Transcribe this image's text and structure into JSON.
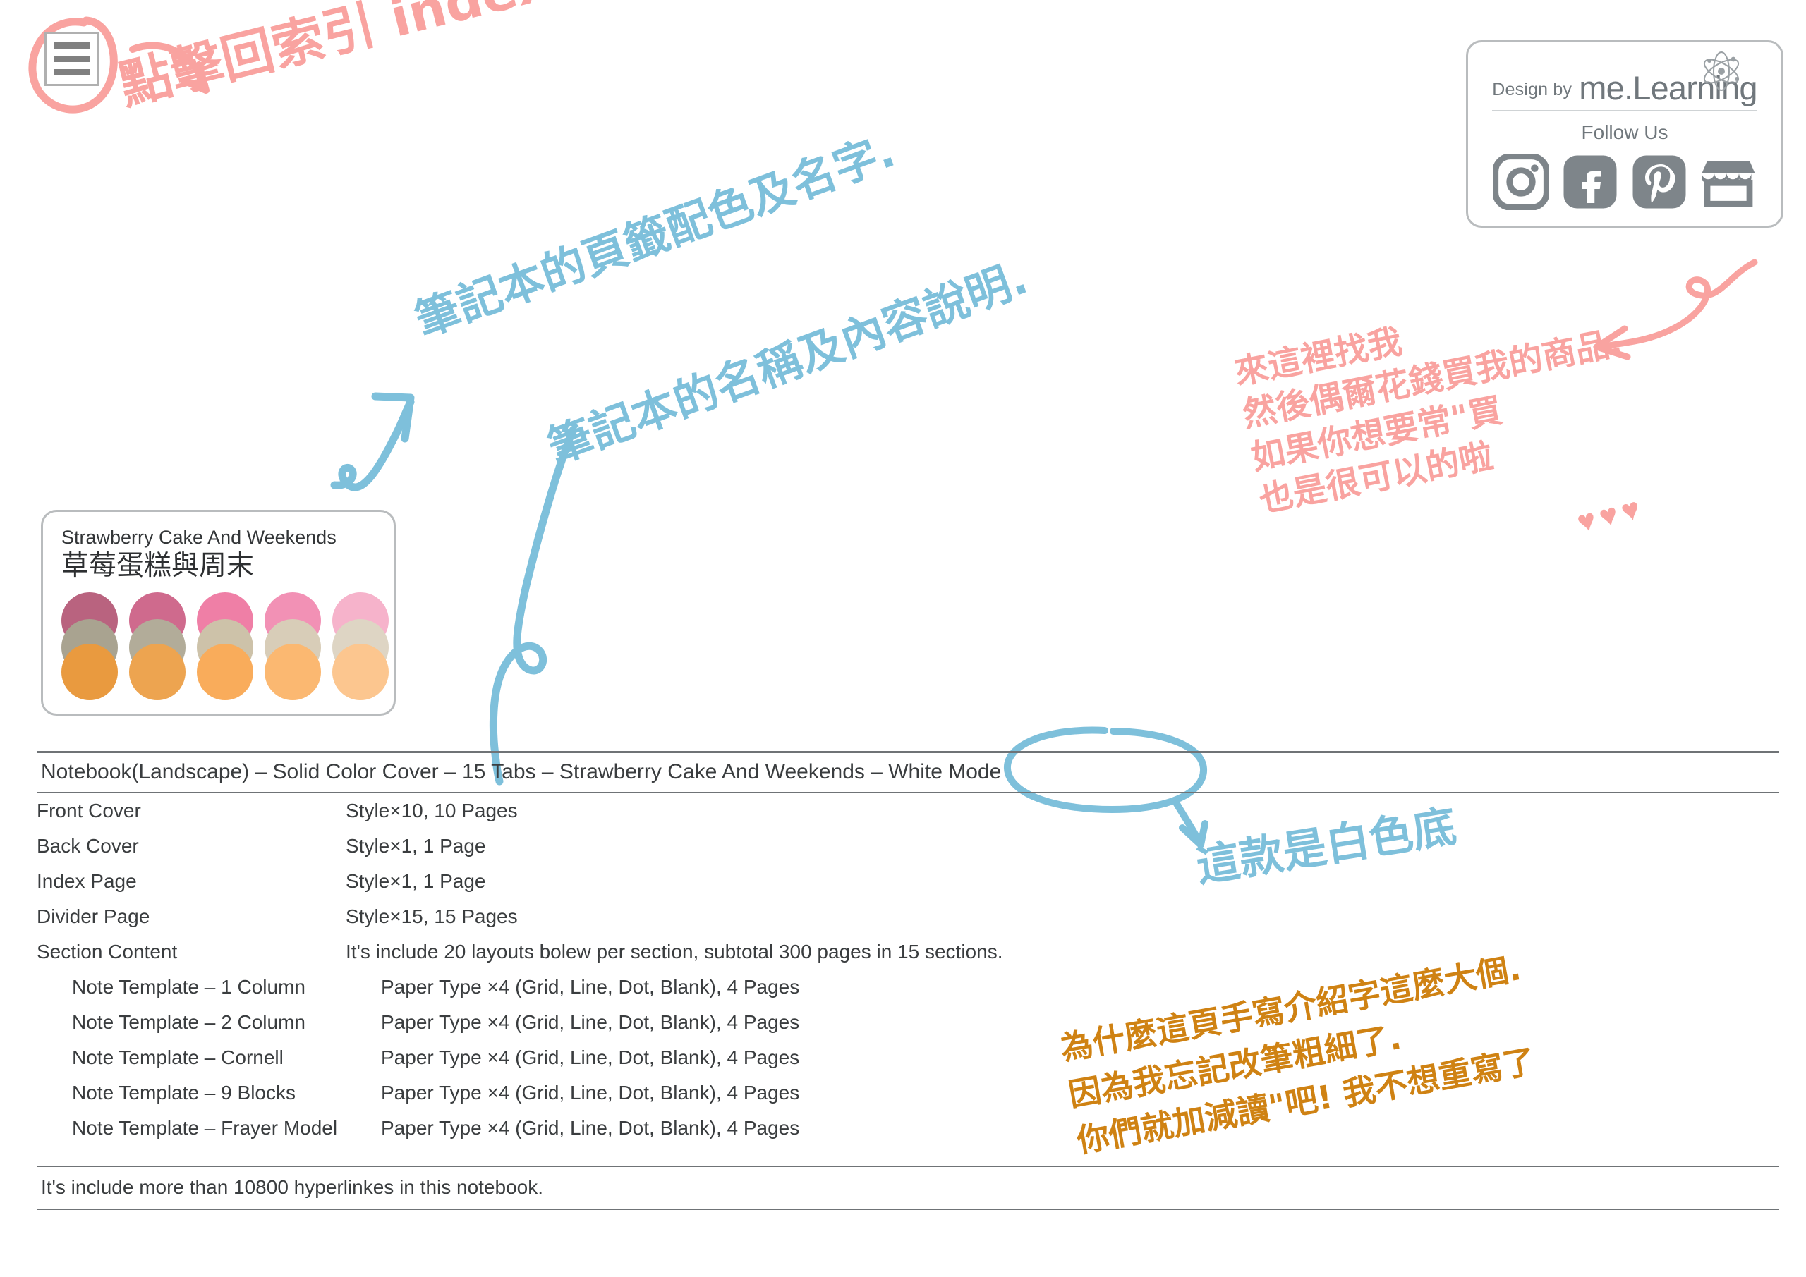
{
  "colors": {
    "pink": "#f9a3a0",
    "blue": "#7ec0db",
    "ochre": "#cf8213",
    "text": "#3a3d3f",
    "brand_gray": "#70777c",
    "border_gray": "#b9bcbe"
  },
  "index_button": {
    "name": "index-menu",
    "bars": 3
  },
  "brand": {
    "design_by": "Design by",
    "logo": "me.Learning",
    "follow_us": "Follow Us",
    "socials": [
      {
        "name": "instagram-icon",
        "label": "Instagram"
      },
      {
        "name": "facebook-icon",
        "label": "Facebook"
      },
      {
        "name": "pinterest-icon",
        "label": "Pinterest"
      },
      {
        "name": "shop-icon",
        "label": "Shop"
      }
    ],
    "atom_icon": "atom-icon"
  },
  "palette": {
    "title_en": "Strawberry Cake And Weekends",
    "title_zh": "草莓蛋糕與周末",
    "columns": [
      {
        "top": "#b9637f",
        "mid": "#a9a390",
        "bottom": "#e99a3f"
      },
      {
        "top": "#cf6a8d",
        "mid": "#b2ac99",
        "bottom": "#eda450"
      },
      {
        "top": "#ef7fa6",
        "mid": "#cdc2a9",
        "bottom": "#f9ac5b"
      },
      {
        "top": "#f291b5",
        "mid": "#d8cdb8",
        "bottom": "#fbb871"
      },
      {
        "top": "#f6b3cb",
        "mid": "#ded5c4",
        "bottom": "#fcc68f"
      }
    ]
  },
  "table": {
    "title": "Notebook(Landscape) – Solid Color Cover – 15 Tabs – Strawberry Cake And Weekends –  White Mode",
    "rows": [
      {
        "label": "Front Cover",
        "value": "Style×10, 10 Pages",
        "indent": 0
      },
      {
        "label": "Back Cover",
        "value": "Style×1, 1 Page",
        "indent": 0
      },
      {
        "label": "Index Page",
        "value": "Style×1, 1 Page",
        "indent": 0
      },
      {
        "label": "Divider Page",
        "value": "Style×15, 15 Pages",
        "indent": 0
      },
      {
        "label": "Section Content",
        "value": "It's include 20 layouts bolew per section, subtotal 300 pages in 15 sections.",
        "indent": 0
      },
      {
        "label": "Note Template – 1 Column",
        "value": "Paper Type ×4 (Grid, Line, Dot, Blank), 4 Pages",
        "indent": 1
      },
      {
        "label": "Note Template – 2 Column",
        "value": "Paper Type ×4 (Grid, Line, Dot, Blank), 4 Pages",
        "indent": 1
      },
      {
        "label": "Note Template – Cornell",
        "value": "Paper Type ×4 (Grid, Line, Dot, Blank), 4 Pages",
        "indent": 1
      },
      {
        "label": "Note Template – 9 Blocks",
        "value": "Paper Type ×4 (Grid, Line, Dot, Blank), 4 Pages",
        "indent": 1
      },
      {
        "label": "Note Template – Frayer Model",
        "value": "Paper Type ×4 (Grid, Line, Dot, Blank), 4 Pages",
        "indent": 1
      }
    ],
    "footer": "It's include more than 10800 hyperlinkes in this notebook."
  },
  "annotations": {
    "index": "點擊回索引 index",
    "tabs": "筆記本的頁籤配色及名字.",
    "name": "筆記本的名稱及內容說明.",
    "shop": "來這裡找我\n然後偶爾花錢買我的商品.\n如果你想要常\"買\n也是很可以的啦",
    "hearts": "♥♥♥",
    "white_mode": "這款是白色底",
    "why": "為什麼這頁手寫介紹字這麼大個.\n因為我忘記改筆粗細了.\n你們就加減讀\"吧! 我不想重寫了"
  }
}
